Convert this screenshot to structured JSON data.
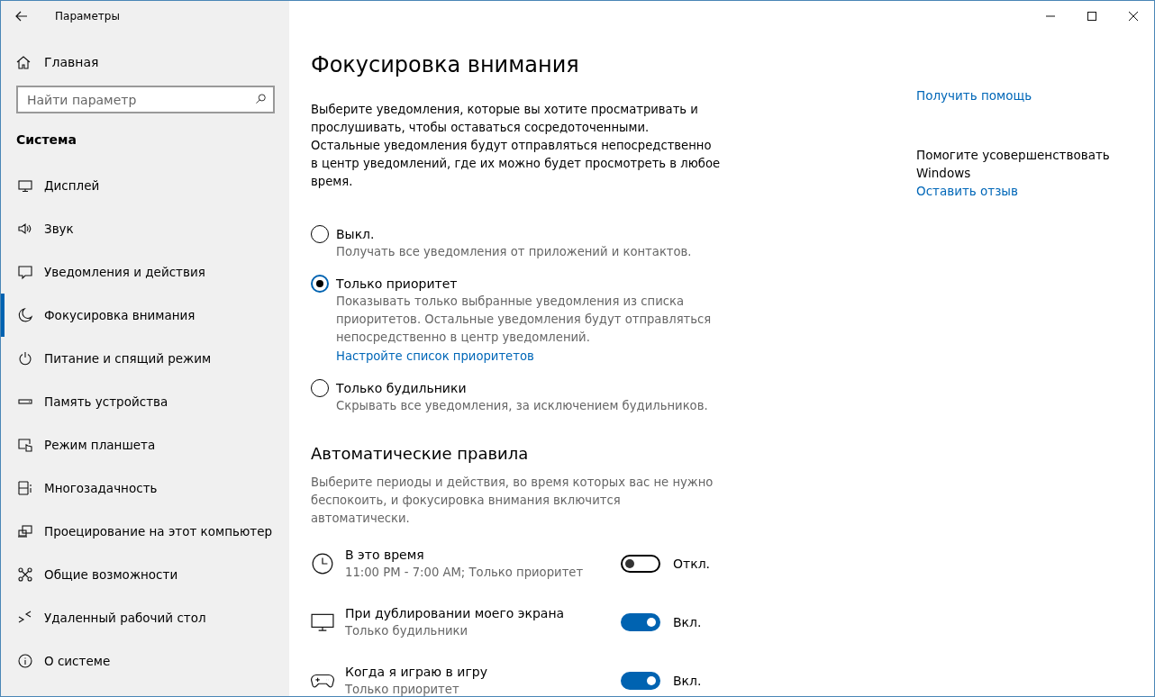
{
  "window": {
    "title": "Параметры"
  },
  "sidebar": {
    "home": "Главная",
    "search": {
      "placeholder": "Найти параметр"
    },
    "section": "Система",
    "items": [
      {
        "label": "Дисплей",
        "selected": false
      },
      {
        "label": "Звук",
        "selected": false
      },
      {
        "label": "Уведомления и действия",
        "selected": false
      },
      {
        "label": "Фокусировка внимания",
        "selected": true
      },
      {
        "label": "Питание и спящий режим",
        "selected": false
      },
      {
        "label": "Память устройства",
        "selected": false
      },
      {
        "label": "Режим планшета",
        "selected": false
      },
      {
        "label": "Многозадачность",
        "selected": false
      },
      {
        "label": "Проецирование на этот компьютер",
        "selected": false
      },
      {
        "label": "Общие возможности",
        "selected": false
      },
      {
        "label": "Удаленный рабочий стол",
        "selected": false
      },
      {
        "label": "О системе",
        "selected": false
      }
    ]
  },
  "page": {
    "title": "Фокусировка внимания",
    "intro": "Выберите уведомления, которые вы хотите просматривать и прослушивать, чтобы оставаться сосредоточенными. Остальные уведомления будут отправляться непосредственно в центр уведомлений, где их можно будет просмотреть в любое время.",
    "options": [
      {
        "label": "Выкл.",
        "description": "Получать все уведомления от приложений и контактов.",
        "selected": false
      },
      {
        "label": "Только приоритет",
        "description": "Показывать только выбранные уведомления из списка приоритетов. Остальные уведомления будут отправляться непосредственно в центр уведомлений.",
        "link": "Настройте список приоритетов",
        "selected": true
      },
      {
        "label": "Только будильники",
        "description": "Скрывать все уведомления, за исключением будильников.",
        "selected": false
      }
    ],
    "rules_title": "Автоматические правила",
    "rules_intro": "Выберите периоды и действия, во время которых вас не нужно беспокоить, и фокусировка внимания включится автоматически.",
    "rules": [
      {
        "kind": "clock",
        "title": "В это время",
        "subtitle": "11:00 PM - 7:00 AM; Только приоритет",
        "on": false,
        "state_label": "Откл."
      },
      {
        "kind": "monitor",
        "title": "При дублировании моего экрана",
        "subtitle": "Только будильники",
        "on": true,
        "state_label": "Вкл."
      },
      {
        "kind": "gamepad",
        "title": "Когда я играю в игру",
        "subtitle": "Только приоритет",
        "on": true,
        "state_label": "Вкл."
      }
    ]
  },
  "aside": {
    "help_link": "Получить помощь",
    "improve_text": "Помогите усовершенствовать Windows",
    "feedback_link": "Оставить отзыв"
  }
}
